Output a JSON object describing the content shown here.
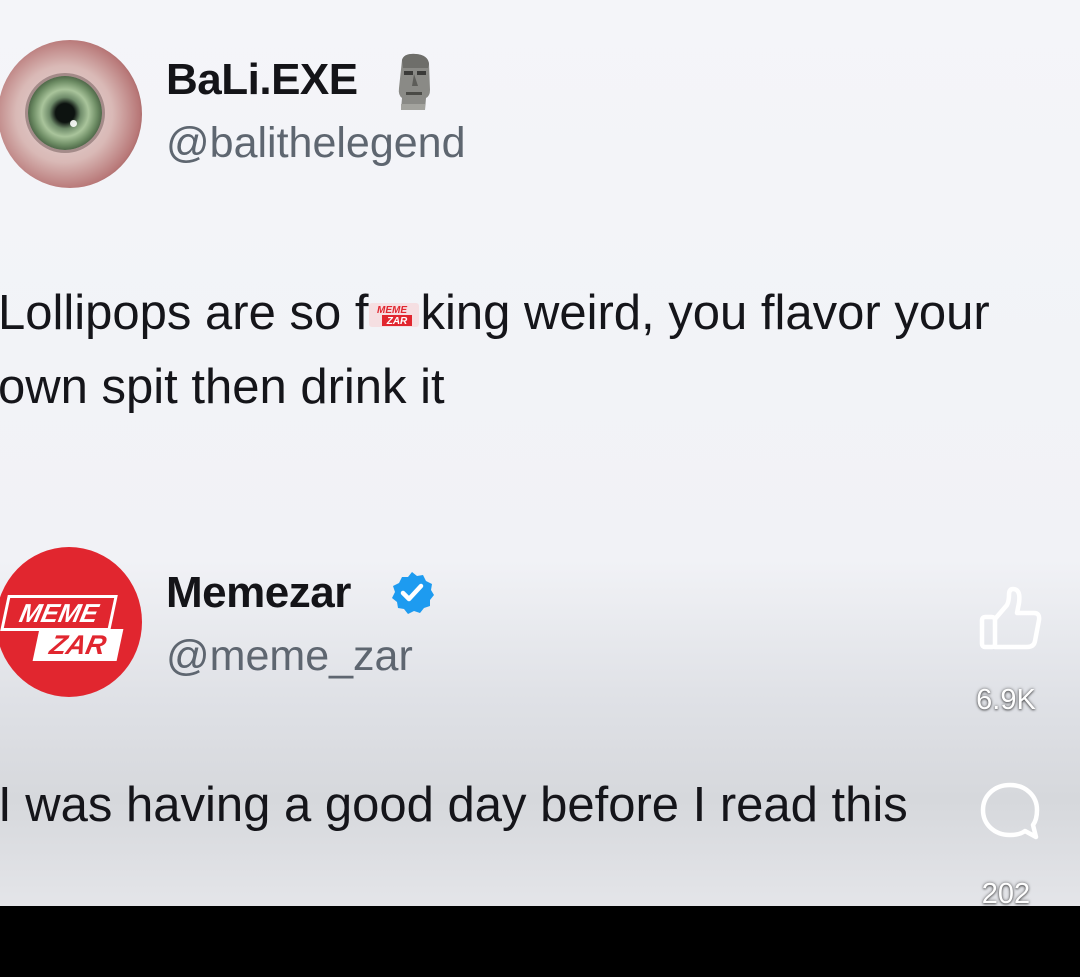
{
  "tweets": [
    {
      "display_name": "BaLi.EXE",
      "handle": "@balithelegend",
      "name_emoji_icon": "moai-icon",
      "text_before": "Lollipops are so f",
      "text_after": "king weird, you flavor your own spit then drink it",
      "watermark_icon": "memezar-watermark-icon"
    },
    {
      "display_name": "Memezar",
      "handle": "@meme_zar",
      "verified_icon": "verified-badge-icon",
      "avatar_logo_line1": "MEME",
      "avatar_logo_line2": "ZAR",
      "text": "I was having a good day before I read this"
    }
  ],
  "actions": {
    "like_icon": "thumbs-up-icon",
    "like_count": "6.9K",
    "comment_icon": "comment-bubble-icon",
    "comment_count": "202"
  },
  "colors": {
    "brand_red": "#e1262f",
    "verified_blue": "#1d9bf0",
    "handle_gray": "#5e6670"
  }
}
